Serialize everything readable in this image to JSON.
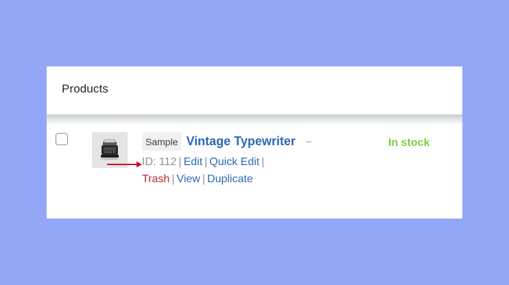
{
  "panel": {
    "title": "Products"
  },
  "product": {
    "badge": "Sample",
    "name": "Vintage Typewriter",
    "dash": "–",
    "stock_status": "In stock",
    "thumbnail_icon": "typewriter-icon",
    "annotation_icon": "red-arrow-icon"
  },
  "row_actions": {
    "id_label": "ID: 112",
    "separator": "|",
    "edit": "Edit",
    "quick_edit": "Quick Edit",
    "trash": "Trash",
    "view": "View",
    "duplicate": "Duplicate"
  },
  "colors": {
    "background": "#94a7f6",
    "link": "#2c6ab6",
    "trash": "#b32d2e",
    "in_stock": "#7ad03a",
    "arrow": "#c8102e"
  }
}
